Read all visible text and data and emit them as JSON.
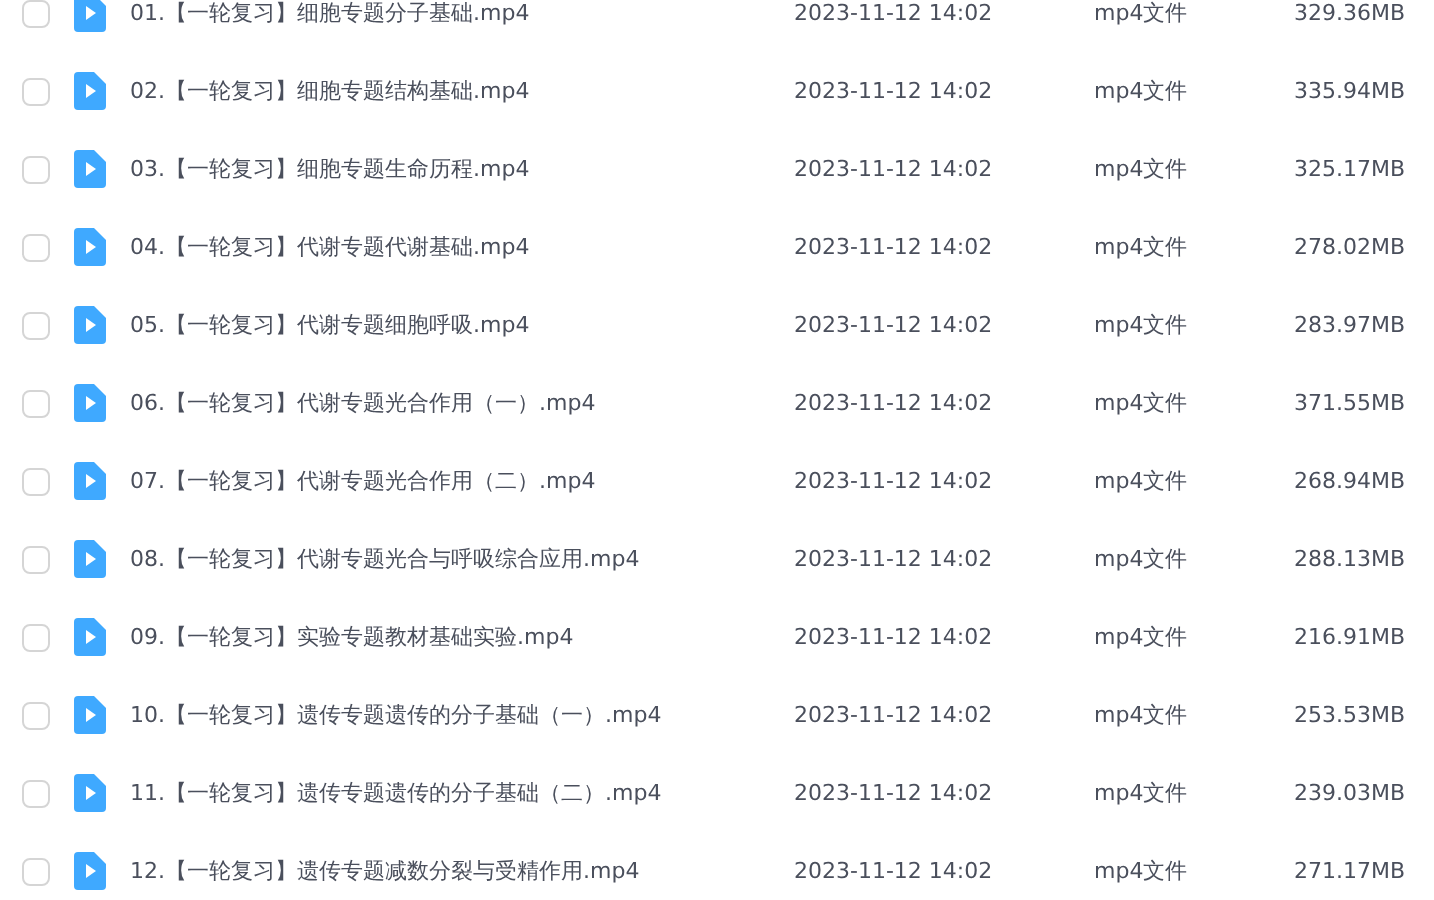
{
  "files": [
    {
      "checked": false,
      "name": "01.【一轮复习】细胞专题分子基础.mp4",
      "modified": "2023-11-12 14:02",
      "type": "mp4文件",
      "size": "329.36MB"
    },
    {
      "checked": false,
      "name": "02.【一轮复习】细胞专题结构基础.mp4",
      "modified": "2023-11-12 14:02",
      "type": "mp4文件",
      "size": "335.94MB"
    },
    {
      "checked": false,
      "name": "03.【一轮复习】细胞专题生命历程.mp4",
      "modified": "2023-11-12 14:02",
      "type": "mp4文件",
      "size": "325.17MB"
    },
    {
      "checked": false,
      "name": "04.【一轮复习】代谢专题代谢基础.mp4",
      "modified": "2023-11-12 14:02",
      "type": "mp4文件",
      "size": "278.02MB"
    },
    {
      "checked": false,
      "name": "05.【一轮复习】代谢专题细胞呼吸.mp4",
      "modified": "2023-11-12 14:02",
      "type": "mp4文件",
      "size": "283.97MB"
    },
    {
      "checked": false,
      "name": "06.【一轮复习】代谢专题光合作用（一）.mp4",
      "modified": "2023-11-12 14:02",
      "type": "mp4文件",
      "size": "371.55MB"
    },
    {
      "checked": false,
      "name": "07.【一轮复习】代谢专题光合作用（二）.mp4",
      "modified": "2023-11-12 14:02",
      "type": "mp4文件",
      "size": "268.94MB"
    },
    {
      "checked": false,
      "name": "08.【一轮复习】代谢专题光合与呼吸综合应用.mp4",
      "modified": "2023-11-12 14:02",
      "type": "mp4文件",
      "size": "288.13MB"
    },
    {
      "checked": false,
      "name": "09.【一轮复习】实验专题教材基础实验.mp4",
      "modified": "2023-11-12 14:02",
      "type": "mp4文件",
      "size": "216.91MB"
    },
    {
      "checked": false,
      "name": "10.【一轮复习】遗传专题遗传的分子基础（一）.mp4",
      "modified": "2023-11-12 14:02",
      "type": "mp4文件",
      "size": "253.53MB"
    },
    {
      "checked": false,
      "name": "11.【一轮复习】遗传专题遗传的分子基础（二）.mp4",
      "modified": "2023-11-12 14:02",
      "type": "mp4文件",
      "size": "239.03MB"
    },
    {
      "checked": false,
      "name": "12.【一轮复习】遗传专题减数分裂与受精作用.mp4",
      "modified": "2023-11-12 14:02",
      "type": "mp4文件",
      "size": "271.17MB"
    }
  ]
}
